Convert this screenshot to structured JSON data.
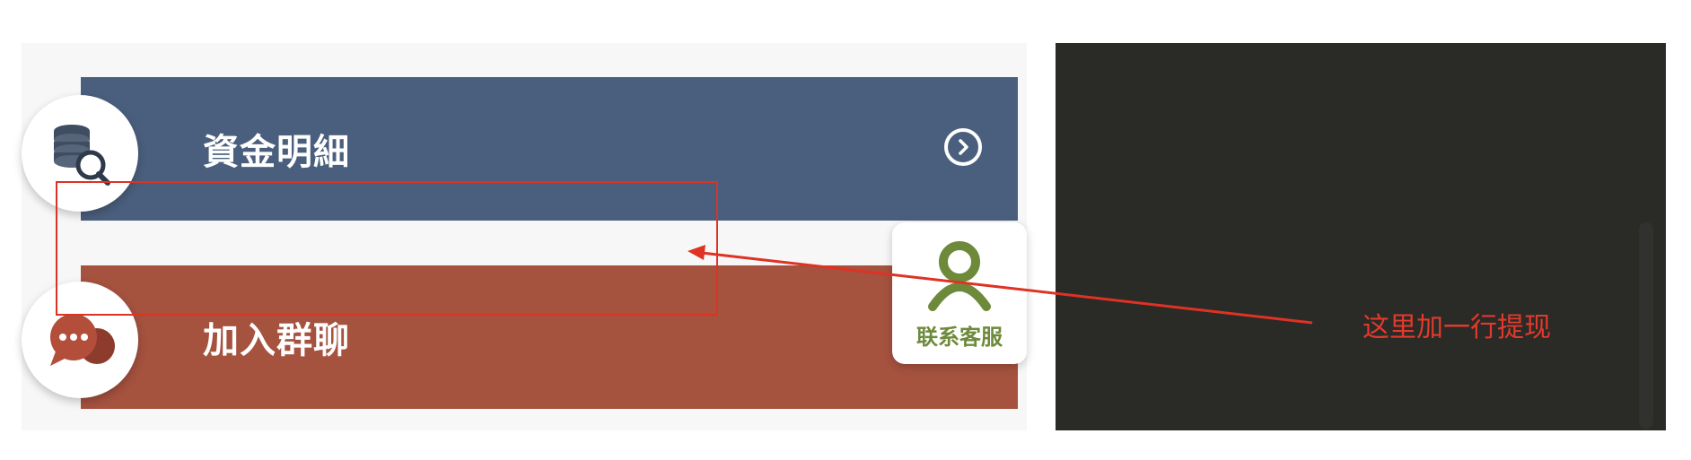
{
  "menu": {
    "funds": {
      "label": "資金明細",
      "icon": "coin-stack-search-icon",
      "action_icon": "chevron-right-circle-icon",
      "color": "#4a5f7d"
    },
    "group": {
      "label": "加入群聊",
      "icon": "chat-bubbles-icon",
      "color": "#a5523f"
    }
  },
  "floating": {
    "service_label": "联系客服",
    "icon": "customer-service-icon",
    "color": "#6d8a3a"
  },
  "annotation": {
    "text": "这里加一行提现",
    "color": "#de3224"
  }
}
